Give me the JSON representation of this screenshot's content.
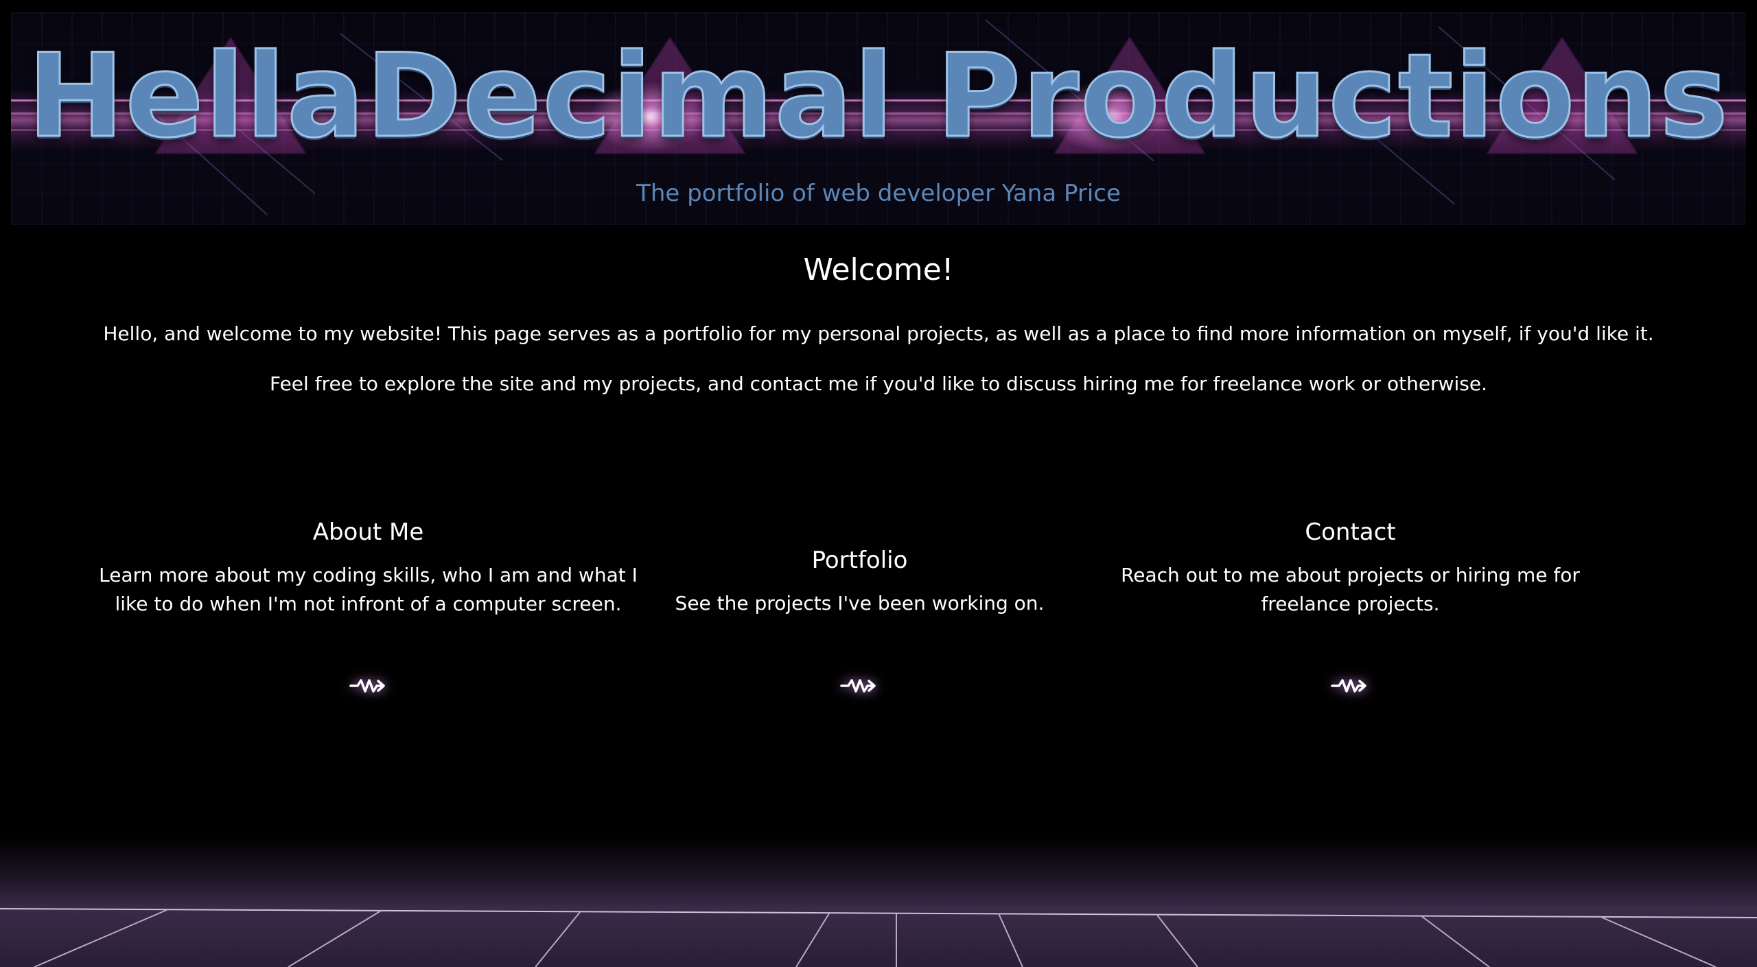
{
  "header": {
    "site_title": "HellaDecimal Productions",
    "tagline": "The portfolio of web developer Yana Price"
  },
  "welcome": {
    "heading": "Welcome!",
    "paragraph_1": "Hello, and welcome to my website! This page serves as a portfolio for my personal projects, as well as a place to find more information on myself, if you'd like it.",
    "paragraph_2": "Feel free to explore the site and my projects, and contact me if you'd like to discuss hiring me for freelance work or otherwise."
  },
  "sections": [
    {
      "title": "About Me",
      "description": "Learn more about my coding skills, who I am and what I like to do when I'm not infront of a computer screen.",
      "link_icon": "zigzag-arrow-icon"
    },
    {
      "title": "Portfolio",
      "description": "See the projects I've been working on.",
      "link_icon": "zigzag-arrow-icon"
    },
    {
      "title": "Contact",
      "description": "Reach out to me about projects or hiring me for freelance projects.",
      "link_icon": "zigzag-arrow-icon"
    }
  ],
  "colors": {
    "background": "#000000",
    "title_blue": "#5b87b8",
    "text": "#ffffff",
    "neon_pink": "#e690da"
  }
}
